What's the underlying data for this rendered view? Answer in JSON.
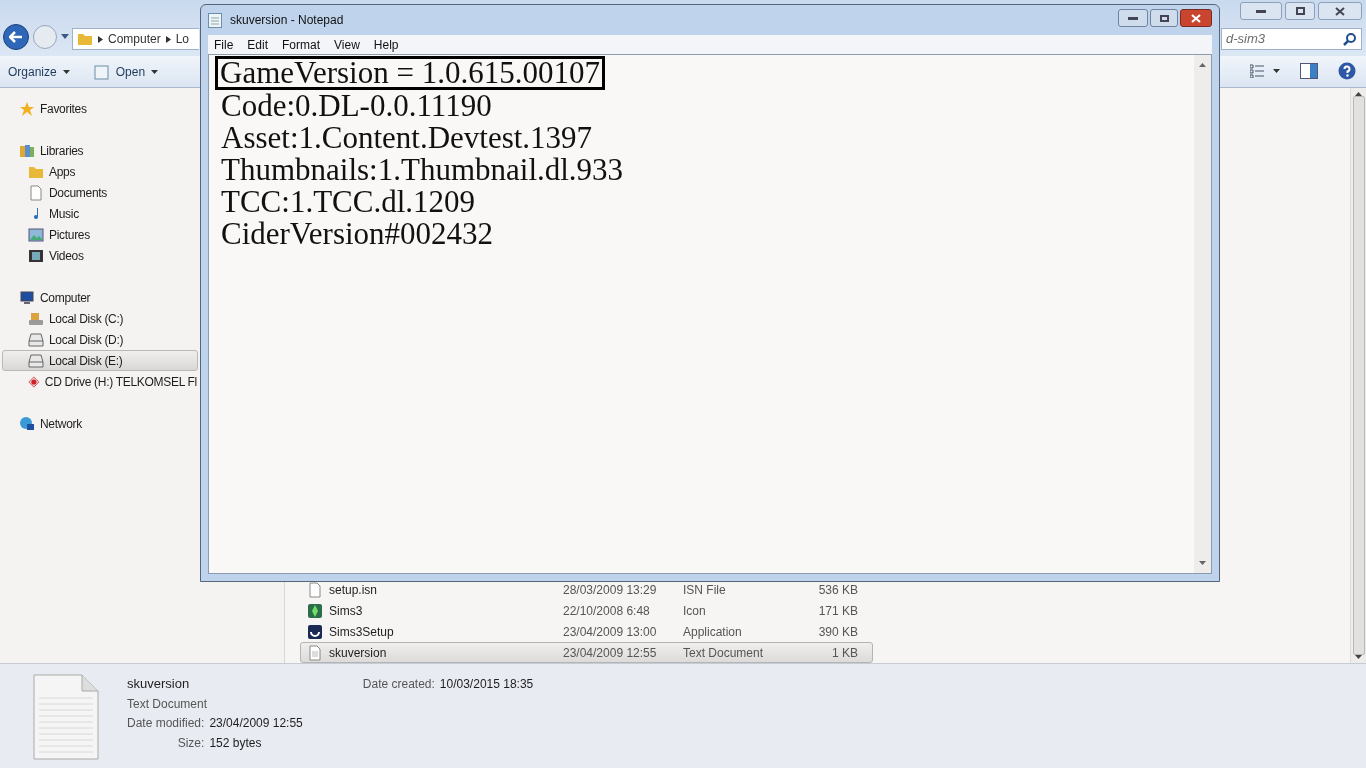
{
  "explorer": {
    "breadcrumb": [
      "Computer",
      "Lo"
    ],
    "search": {
      "placeholder": "d-sim3"
    },
    "toolbar": [
      "Organize",
      "Open"
    ],
    "sidebar": [
      {
        "label": "Favorites",
        "selected": false
      },
      {
        "label": "Libraries",
        "selected": false,
        "children": [
          {
            "label": "Apps",
            "selected": false
          },
          {
            "label": "Documents",
            "selected": false
          },
          {
            "label": "Music",
            "selected": false
          },
          {
            "label": "Pictures",
            "selected": false
          },
          {
            "label": "Videos",
            "selected": false
          }
        ]
      },
      {
        "label": "Computer",
        "selected": false,
        "children": [
          {
            "label": "Local Disk (C:)",
            "selected": false
          },
          {
            "label": "Local Disk (D:)",
            "selected": false
          },
          {
            "label": "Local Disk (E:)",
            "selected": true
          },
          {
            "label": "CD Drive (H:) TELKOMSEL Fl",
            "selected": false
          }
        ]
      },
      {
        "label": "Network",
        "selected": false
      }
    ],
    "files": [
      {
        "name": "setup.isn",
        "date": "28/03/2009 13:29",
        "type": "ISN File",
        "size": "536 KB",
        "selected": false
      },
      {
        "name": "Sims3",
        "date": "22/10/2008 6:48",
        "type": "Icon",
        "size": "171 KB",
        "selected": false
      },
      {
        "name": "Sims3Setup",
        "date": "23/04/2009 13:00",
        "type": "Application",
        "size": "390 KB",
        "selected": false
      },
      {
        "name": "skuversion",
        "date": "23/04/2009 12:55",
        "type": "Text Document",
        "size": "1 KB",
        "selected": true
      }
    ],
    "details": {
      "name": "skuversion",
      "type": "Text Document",
      "fields": [
        {
          "label": "Date modified:",
          "value": "23/04/2009 12:55"
        },
        {
          "label": "Size:",
          "value": "152 bytes"
        }
      ],
      "created": {
        "label": "Date created:",
        "value": "10/03/2015 18:35"
      }
    }
  },
  "notepad": {
    "title": "skuversion - Notepad",
    "menu": [
      "File",
      "Edit",
      "Format",
      "View",
      "Help"
    ],
    "lines": [
      {
        "text": "GameVersion = 1.0.615.00107",
        "boxed": true
      },
      {
        "text": "Code:0.DL-0.0.11190",
        "boxed": false
      },
      {
        "text": "Asset:1.Content.Devtest.1397",
        "boxed": false
      },
      {
        "text": "Thumbnails:1.Thumbnail.dl.933",
        "boxed": false
      },
      {
        "text": "TCC:1.TCC.dl.1209",
        "boxed": false
      },
      {
        "text": "CiderVersion#002432",
        "boxed": false
      }
    ]
  }
}
